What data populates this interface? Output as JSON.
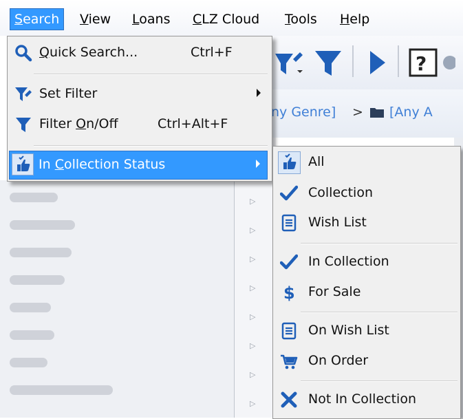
{
  "menubar": {
    "items": [
      {
        "label": "Search",
        "accel": "S",
        "rest": "earch"
      },
      {
        "label": "View",
        "accel": "V",
        "rest": "iew"
      },
      {
        "label": "Loans",
        "accel": "L",
        "rest": "oans"
      },
      {
        "label": "CLZ Cloud",
        "accel": "C",
        "rest": "LZ Cloud"
      },
      {
        "label": "Tools",
        "accel": "T",
        "rest": "ools"
      },
      {
        "label": "Help",
        "accel": "H",
        "rest": "elp"
      }
    ]
  },
  "search_menu": {
    "quick_search": {
      "label": "Quick Search...",
      "accel": "Q",
      "rest": "uick Search...",
      "shortcut": "Ctrl+F",
      "icon": "magnifier-icon"
    },
    "set_filter": {
      "label": "Set Filter",
      "icon": "filter-edit-icon"
    },
    "filter_onoff": {
      "pre": "Filter ",
      "accel": "O",
      "rest": "n/Off",
      "shortcut": "Ctrl+Alt+F",
      "icon": "filter-icon"
    },
    "in_collection_status": {
      "pre": "In ",
      "accel": "C",
      "rest": "ollection Status",
      "icon": "collection-hand-icon"
    }
  },
  "status_submenu": {
    "items": [
      {
        "label": "All",
        "icon": "collection-hand-icon",
        "checked": true
      },
      {
        "label": "Collection",
        "icon": "checkmark-icon"
      },
      {
        "label": "Wish List",
        "icon": "list-icon"
      },
      {
        "label": "In Collection",
        "icon": "checkmark-icon"
      },
      {
        "label": "For Sale",
        "icon": "dollar-icon"
      },
      {
        "label": "On Wish List",
        "icon": "list-icon"
      },
      {
        "label": "On Order",
        "icon": "cart-icon"
      },
      {
        "label": "Not In Collection",
        "icon": "cross-icon"
      }
    ]
  },
  "background": {
    "breadcrumb_genre": "ny Genre]",
    "breadcrumb_sep": ">",
    "breadcrumb_next": "[Any A"
  },
  "colors": {
    "accent": "#3399ff",
    "icon_blue": "#1f5fb8",
    "menu_bg": "#f0f0f0"
  }
}
